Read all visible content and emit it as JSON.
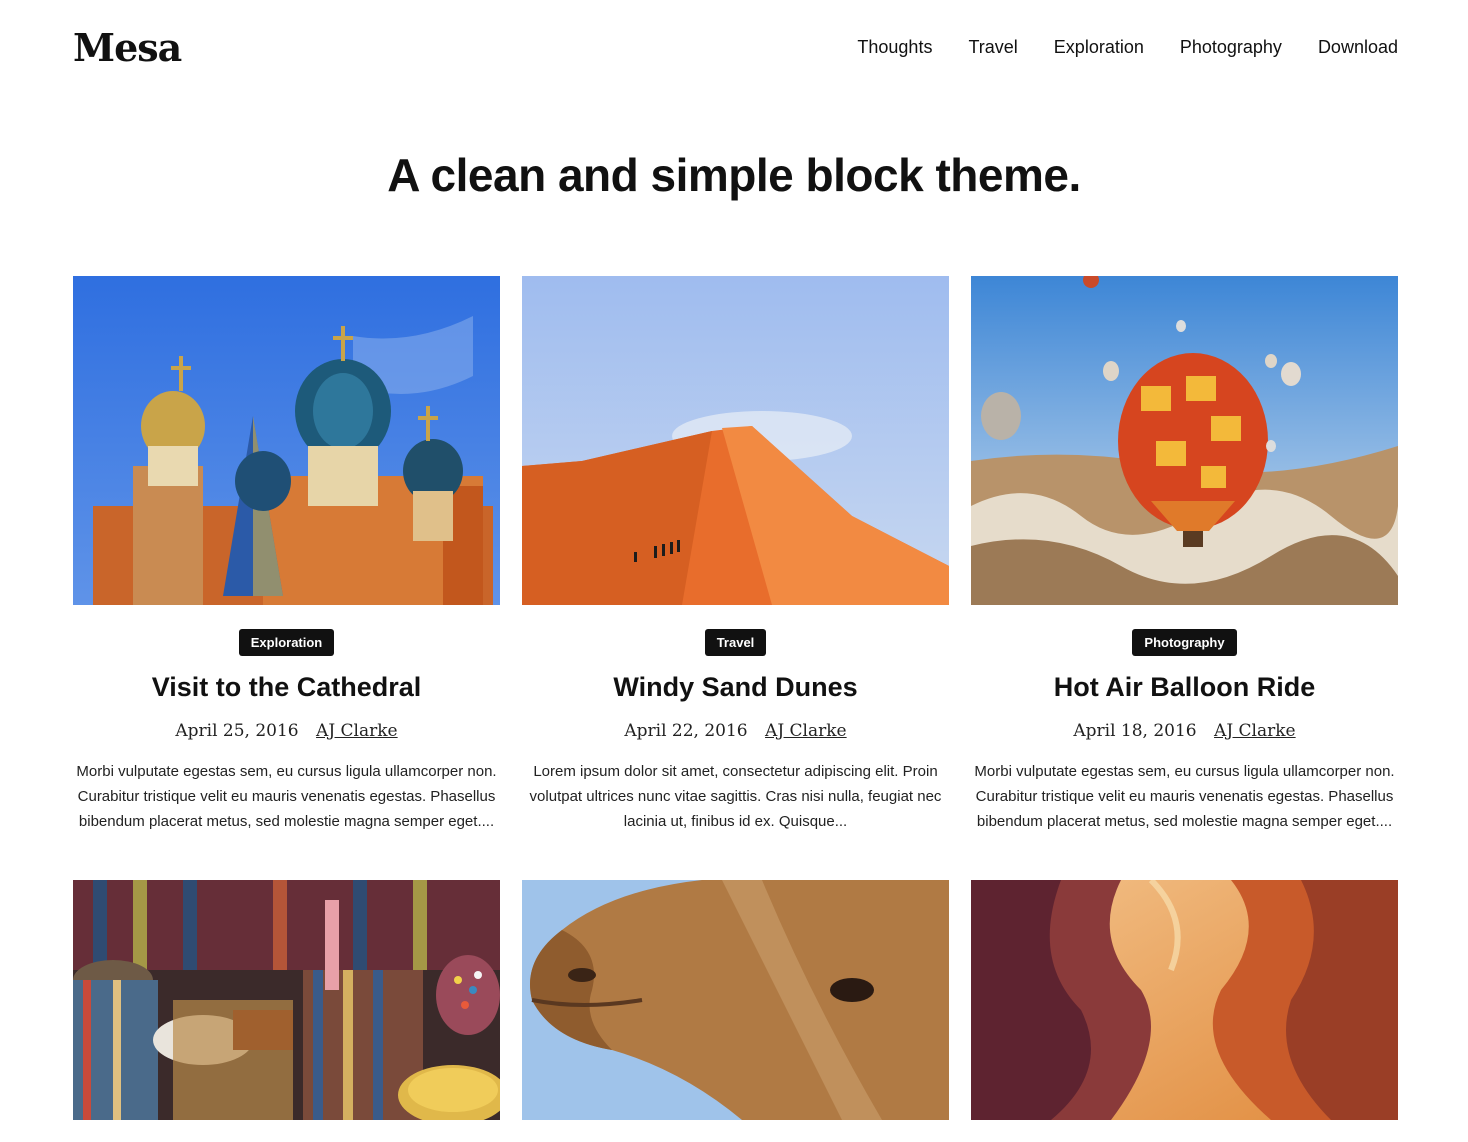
{
  "site": {
    "name": "Mesa"
  },
  "nav": [
    "Thoughts",
    "Travel",
    "Exploration",
    "Photography",
    "Download"
  ],
  "tagline": "A clean and simple block theme.",
  "posts": [
    {
      "category": "Exploration",
      "title": "Visit to the Cathedral",
      "date": "April 25, 2016",
      "author": "AJ Clarke",
      "excerpt": "Morbi vulputate egestas sem, eu cursus ligula ullamcorper non. Curabitur tristique velit eu mauris venenatis egestas. Phasellus bibendum placerat metus, sed molestie magna semper eget...."
    },
    {
      "category": "Travel",
      "title": "Windy Sand Dunes",
      "date": "April 22, 2016",
      "author": "AJ Clarke",
      "excerpt": "Lorem ipsum dolor sit amet, consectetur adipiscing elit. Proin volutpat ultrices nunc vitae sagittis. Cras nisi nulla, feugiat nec lacinia ut, finibus id ex. Quisque..."
    },
    {
      "category": "Photography",
      "title": "Hot Air Balloon Ride",
      "date": "April 18, 2016",
      "author": "AJ Clarke",
      "excerpt": "Morbi vulputate egestas sem, eu cursus ligula ullamcorper non. Curabitur tristique velit eu mauris venenatis egestas. Phasellus bibendum placerat metus, sed molestie magna semper eget...."
    }
  ],
  "colors": {
    "text": "#111111",
    "badge_bg": "#111111",
    "badge_text": "#ffffff",
    "background": "#ffffff"
  }
}
